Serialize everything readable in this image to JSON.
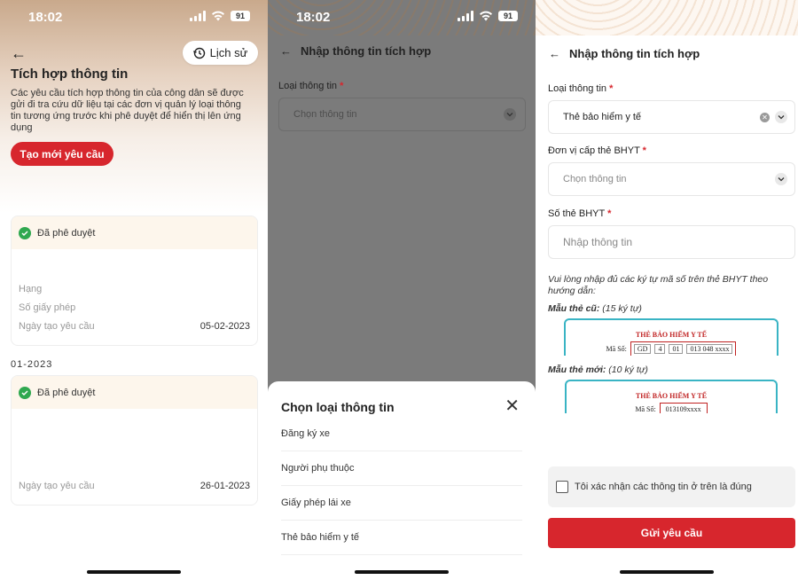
{
  "colors": {
    "primary": "#d7262d",
    "approved": "#2fa84f",
    "sheet_bg": "#ffffff",
    "overlay": "#7b7b7b",
    "card_header": "#fdf6ec"
  },
  "screen1": {
    "status": {
      "time": "18:02",
      "battery": "91"
    },
    "back_icon": "arrow-left-icon",
    "history_label": "Lịch sử",
    "title": "Tích hợp thông tin",
    "description": "Các yêu cầu tích hợp thông tin của công dân sẽ được gửi đi tra cứu dữ liệu tại các đơn vị quản lý loại thông tin tương ứng trước khi phê duyệt để hiển thị lên ứng dụng",
    "new_request_label": "Tạo mới yêu cầu",
    "partial_date_text": "01-2023",
    "cards": [
      {
        "status": "Đã phê duyệt",
        "fields": [
          {
            "label": "Hạng",
            "value": ""
          },
          {
            "label": "Số giấy phép",
            "value": ""
          },
          {
            "label": "Ngày tạo yêu cầu",
            "value": "05-02-2023"
          }
        ]
      },
      {
        "status": "Đã phê duyệt",
        "fields": [
          {
            "label": "Ngày tạo yêu cầu",
            "value": "26-01-2023"
          }
        ]
      }
    ]
  },
  "screen2": {
    "status": {
      "time": "18:02",
      "battery": "91"
    },
    "nav_title": "Nhập thông tin tích hợp",
    "field_label": "Loại thông tin",
    "required_mark": "*",
    "field_placeholder": "Chọn thông tin",
    "sheet_title": "Chọn loại thông tin",
    "options": [
      "Đăng ký xe",
      "Người phụ thuộc",
      "Giấy phép lái xe",
      "Thẻ bảo hiểm y tế"
    ],
    "highlighted_option": "Thẻ bảo hiểm y tế"
  },
  "screen3": {
    "nav_title": "Nhập thông tin tích hợp",
    "fields": [
      {
        "label": "Loại thông tin",
        "required": "*",
        "value": "Thẻ bảo hiểm y tế"
      },
      {
        "label": "Đơn vị cấp thẻ BHYT",
        "required": "*",
        "placeholder": "Chọn thông tin"
      },
      {
        "label": "Số thẻ BHYT",
        "required": "*",
        "placeholder": "Nhập thông tin"
      }
    ],
    "note": "Vui lòng nhập đủ các ký tự mã số trên thẻ BHYT theo hướng dẫn:",
    "old_sample": {
      "label_bold": "Mẫu thẻ cũ:",
      "label_rest": " (15 ký tự)",
      "card_title": "THẺ BẢO HIỂM Y TẾ",
      "code_label": "Mã Số:",
      "code_parts": [
        "GD",
        "4",
        "01",
        "013 048 xxxx"
      ]
    },
    "new_sample": {
      "label_bold": "Mẫu thẻ mới:",
      "label_rest": " (10 ký tự)",
      "card_title": "THẺ BẢO HIỂM Y TẾ",
      "code_label": "Mã Số:",
      "code": "013109xxxx"
    },
    "confirm_label": "Tôi xác nhận các thông tin ở trên là đúng",
    "submit_label": "Gửi yêu cầu"
  }
}
